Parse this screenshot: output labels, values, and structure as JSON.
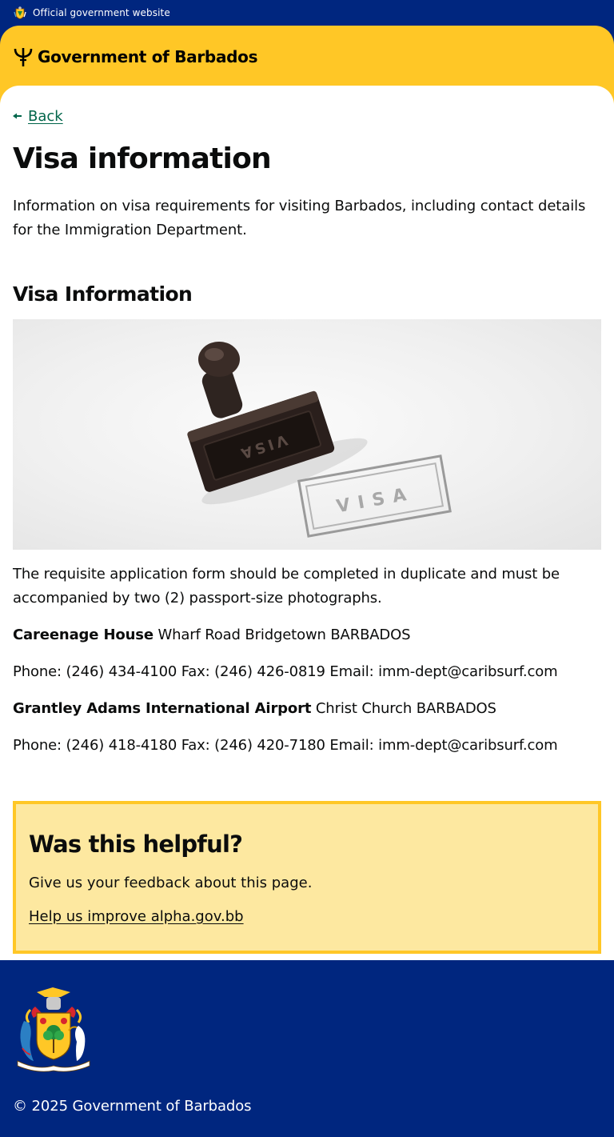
{
  "topbar": {
    "official_label": "Official government website"
  },
  "header": {
    "brand_name": "Government of Barbados"
  },
  "nav": {
    "back_label": "Back"
  },
  "page": {
    "title": "Visa information",
    "lede": "Information on visa requirements for visiting Barbados, including contact details for the Immigration Department."
  },
  "section": {
    "heading": "Visa Information",
    "image": {
      "stamp_text": "VISA",
      "handle_text": "VISA"
    },
    "intro": "The requisite application form should be completed in duplicate and must be accompanied by two (2) passport-size photographs.",
    "offices": [
      {
        "name": "Careenage House",
        "address": "Wharf Road Bridgetown BARBADOS",
        "contact": "Phone: (246) 434-4100 Fax: (246) 426-0819 Email: imm-dept@caribsurf.com"
      },
      {
        "name": "Grantley Adams International Airport",
        "address": "Christ Church BARBADOS",
        "contact": "Phone: (246) 418-4180 Fax: (246) 420-7180 Email: imm-dept@caribsurf.com"
      }
    ]
  },
  "feedback": {
    "heading": "Was this helpful?",
    "text": "Give us your feedback about this page.",
    "link_label": "Help us improve alpha.gov.bb"
  },
  "footer": {
    "coat_motto": "PRIDE AND INDUSTRY",
    "copyright": "© 2025 Government of Barbados"
  },
  "colors": {
    "navy": "#00267f",
    "gold": "#ffc726",
    "feedback_bg": "#fde8a0",
    "link_green": "#00654a"
  },
  "icons": {
    "topbar": "coat-of-arms-icon",
    "brand": "trident-icon",
    "back": "arrow-left-icon"
  }
}
